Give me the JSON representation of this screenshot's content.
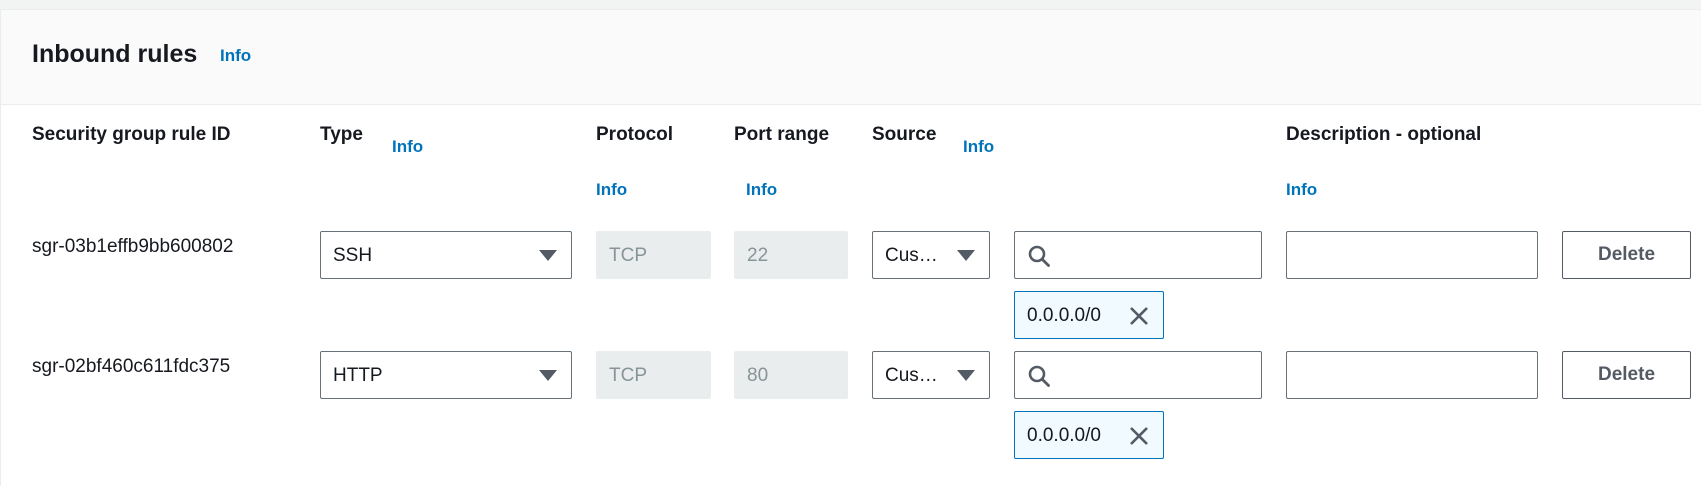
{
  "panel": {
    "title": "Inbound rules",
    "info_label": "Info"
  },
  "columns": {
    "rule_id": "Security group rule ID",
    "type": "Type",
    "type_info": "Info",
    "protocol": "Protocol",
    "protocol_info": "Info",
    "port_range": "Port range",
    "port_range_info": "Info",
    "source": "Source",
    "source_info": "Info",
    "description": "Description - optional",
    "description_info": "Info"
  },
  "rules": [
    {
      "id": "sgr-03b1effb9bb600802",
      "type": "SSH",
      "protocol": "TCP",
      "port_range": "22",
      "source_type": "Cus…",
      "search_value": "",
      "cidr_token": "0.0.0.0/0",
      "description": "",
      "delete_label": "Delete"
    },
    {
      "id": "sgr-02bf460c611fdc375",
      "type": "HTTP",
      "protocol": "TCP",
      "port_range": "80",
      "source_type": "Cus…",
      "search_value": "",
      "cidr_token": "0.0.0.0/0",
      "description": "",
      "delete_label": "Delete"
    }
  ],
  "colors": {
    "link": "#0073bb",
    "border": "#687078",
    "disabled_bg": "#eaeded",
    "token_bg": "#f1faff"
  },
  "icons": {
    "search": "search-icon",
    "dropdown": "caret-down-icon",
    "remove_token": "close-icon"
  }
}
